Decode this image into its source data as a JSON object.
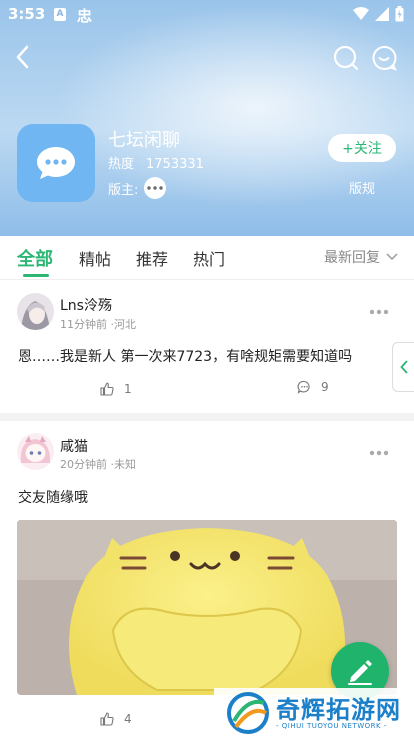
{
  "status_bar": {
    "time": "3:53",
    "a_badge": "A",
    "app_glyph": "忠"
  },
  "forum": {
    "name": "七坛闲聊",
    "heat_label": "热度",
    "heat_value": "1753331",
    "moderator_label": "版主:",
    "follow_label": "+关注",
    "rules_label": "版规"
  },
  "tabs": {
    "items": [
      "全部",
      "精帖",
      "推荐",
      "热门"
    ],
    "sort_label": "最新回复"
  },
  "posts": [
    {
      "username": "Lns泠殇",
      "meta": "11分钟前 ·河北",
      "content": "恩……我是新人 第一次来7723，有啥规矩需要知道吗",
      "likes": "1",
      "comments": "9"
    },
    {
      "username": "咸猫",
      "meta": "20分钟前 ·未知",
      "content": "交友随缘哦",
      "likes": "4"
    }
  ],
  "watermark": {
    "title": "奇辉拓游网",
    "subtitle": "- QIHUI TUOYOU NETWORK -"
  },
  "colors": {
    "accent": "#2bb673",
    "header": "#9ac4ea"
  }
}
